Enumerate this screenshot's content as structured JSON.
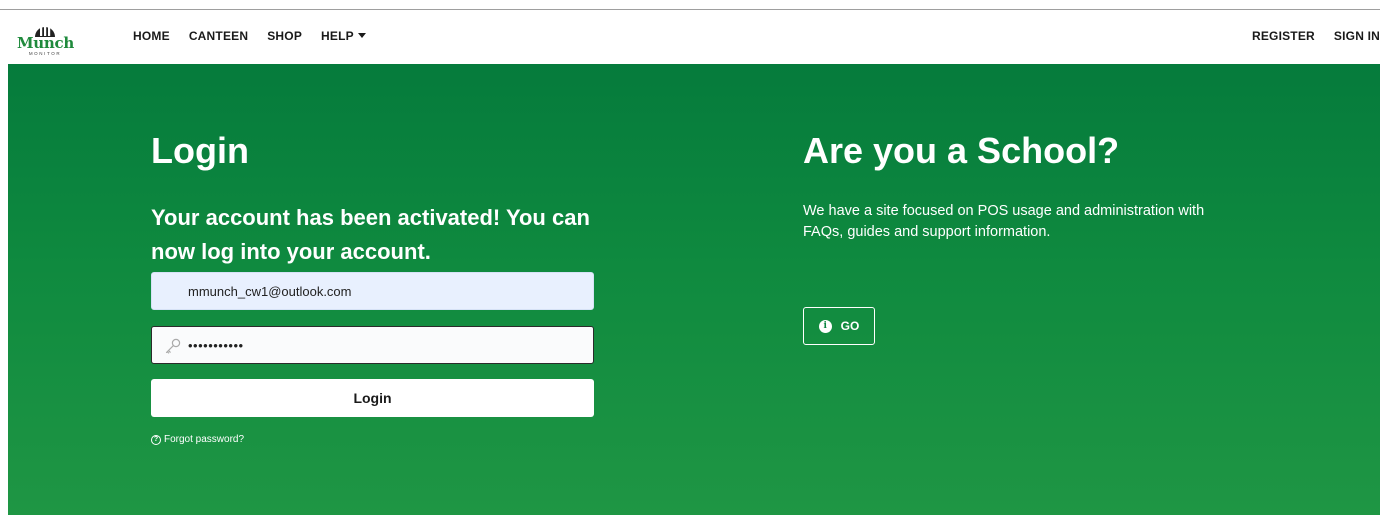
{
  "brand": {
    "name": "Munch",
    "sub": "MONITOR",
    "color": "#1f8a3c"
  },
  "nav": {
    "left": [
      {
        "label": "HOME"
      },
      {
        "label": "CANTEEN"
      },
      {
        "label": "SHOP"
      },
      {
        "label": "HELP"
      }
    ],
    "right": [
      {
        "label": "REGISTER"
      },
      {
        "label": "SIGN IN"
      }
    ]
  },
  "login": {
    "title": "Login",
    "message": "Your account has been activated! You can now log into your account.",
    "email_value": "mmunch_cw1@outlook.com",
    "password_value": "•••••••••••",
    "button_label": "Login",
    "forgot_label": "Forgot password?"
  },
  "school": {
    "title": "Are you a School?",
    "text": "We have a site focused on POS usage and administration with FAQs, guides and support information.",
    "go_label": "GO"
  },
  "colors": {
    "hero_top": "#057b3c",
    "hero_bottom": "#1f9644"
  }
}
